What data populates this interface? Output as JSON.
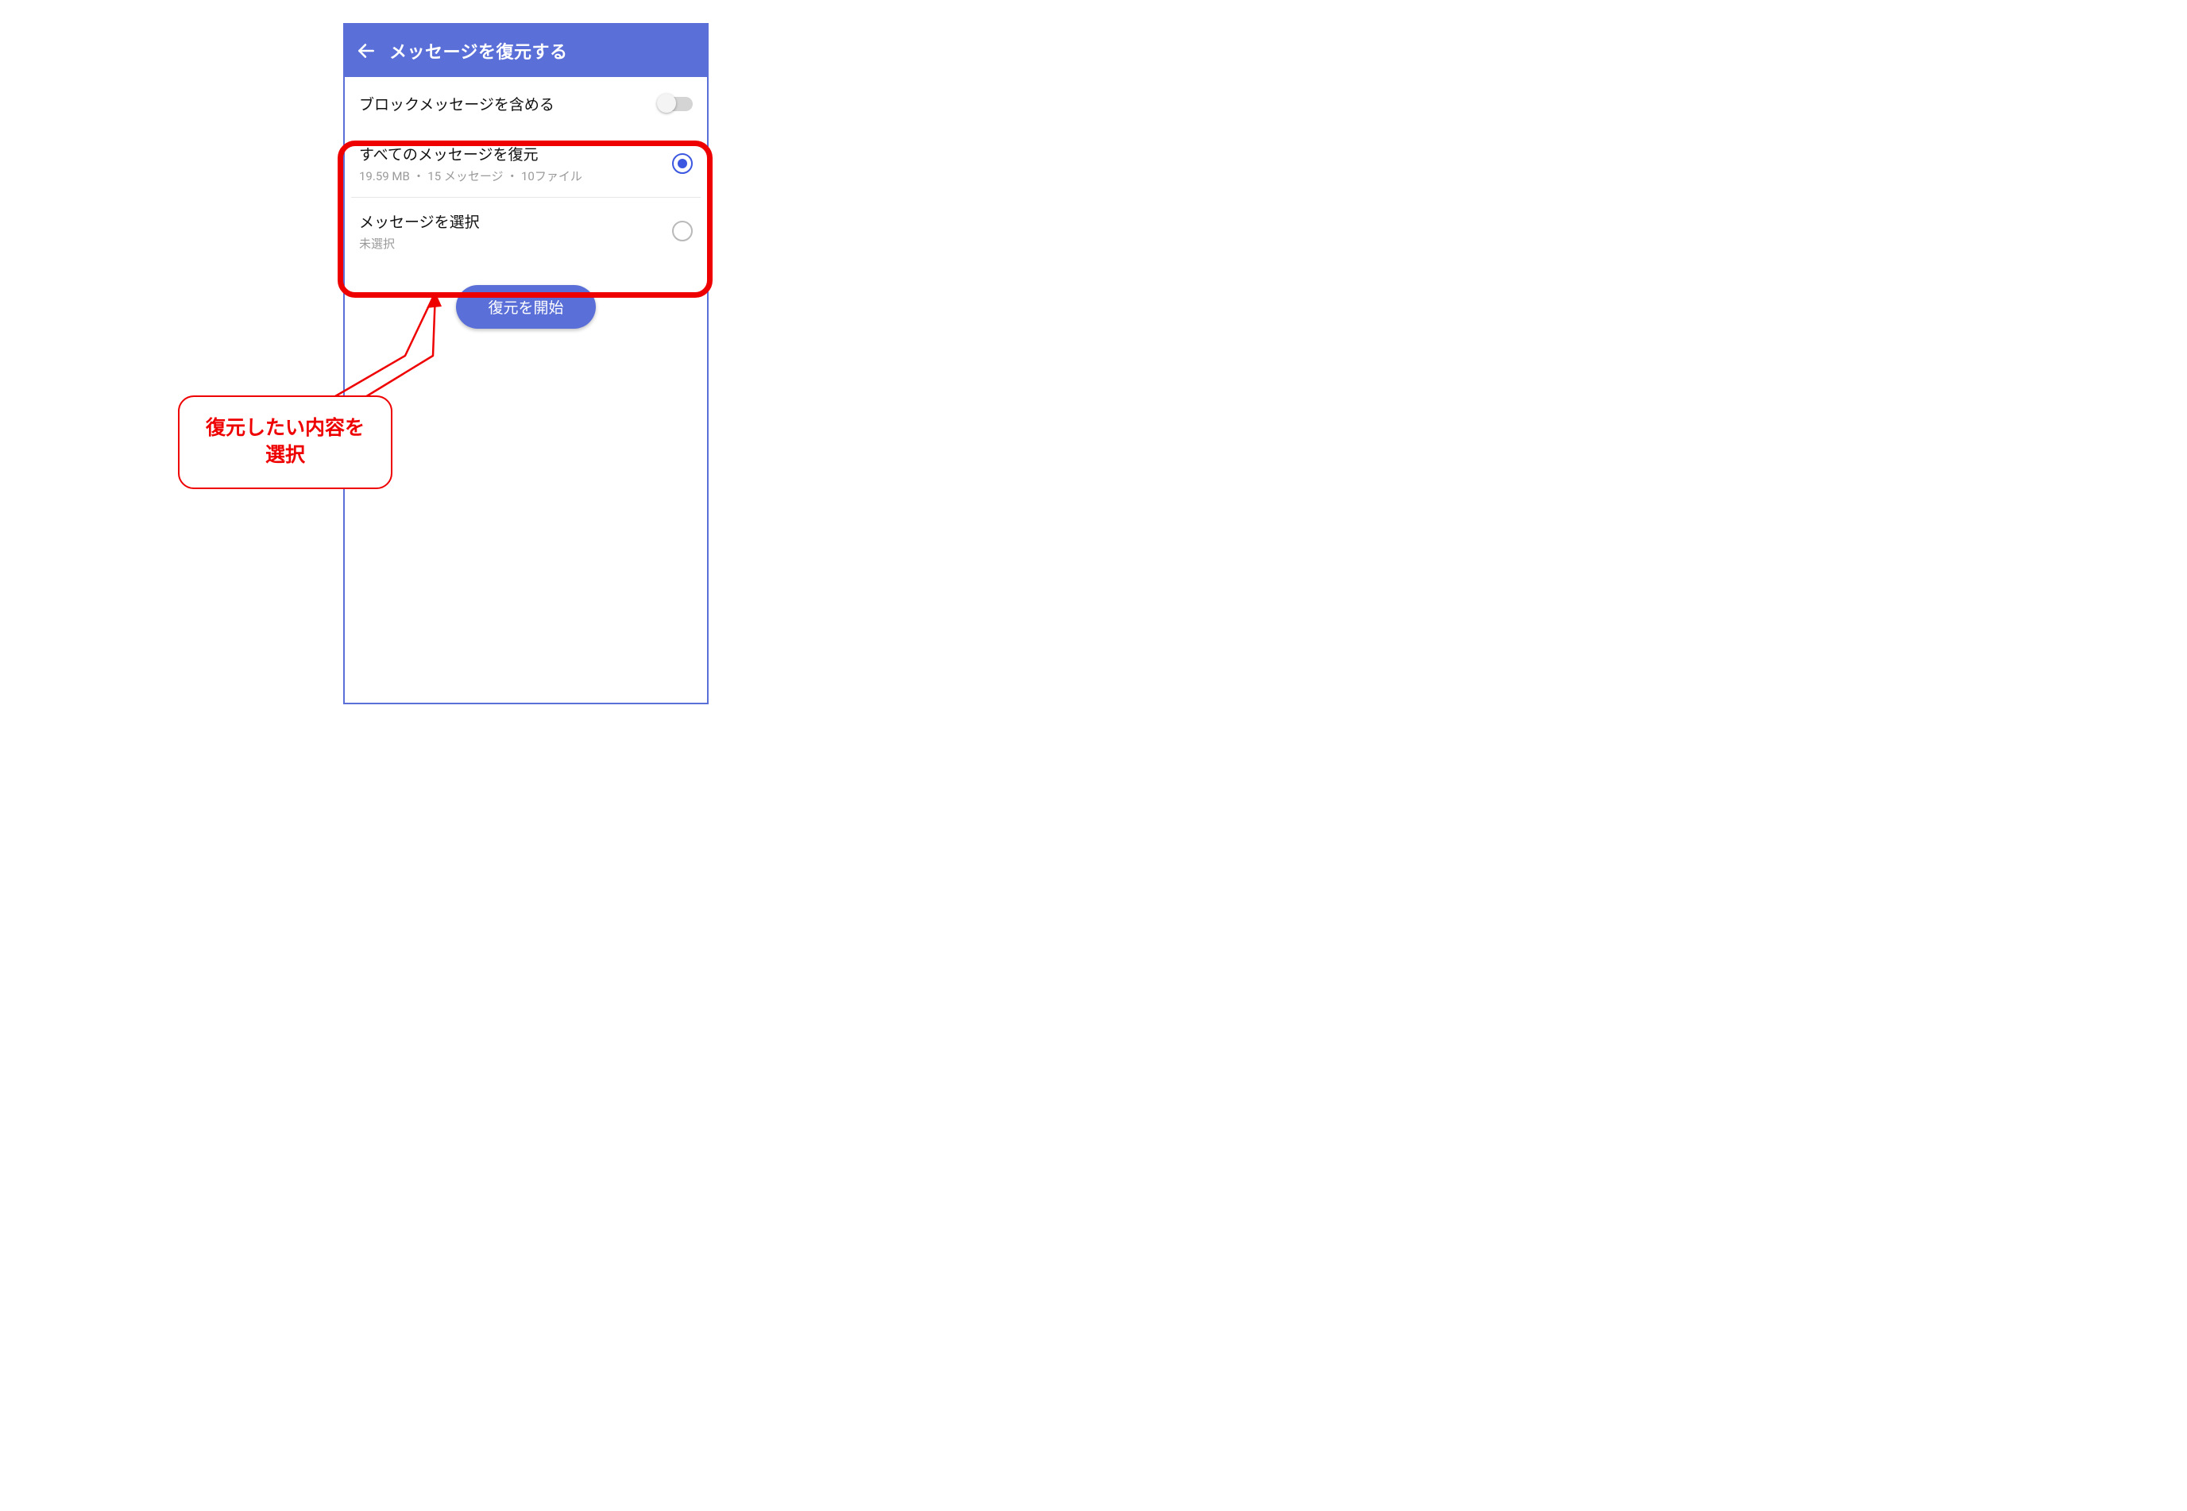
{
  "colors": {
    "primary": "#5a6fd8",
    "accent": "#3c57e0",
    "annotation": "#ef0000"
  },
  "app_bar": {
    "back_icon": "back-arrow-icon",
    "title": "メッセージを復元する"
  },
  "rows": {
    "include_blocked": {
      "label": "ブロックメッセージを含める",
      "toggle_on": false
    }
  },
  "options": {
    "restore_all": {
      "title": "すべてのメッセージを復元",
      "sub_size": "19.59 MB",
      "sub_messages": "15 メッセージ",
      "sub_files": "10ファイル",
      "sub_full": "19.59 MB ・ 15 メッセージ ・ 10ファイル",
      "selected": true
    },
    "select_messages": {
      "title": "メッセージを選択",
      "sub": "未選択",
      "selected": false
    }
  },
  "primary_button": {
    "label": "復元を開始"
  },
  "annotation": {
    "callout_line1": "復元したい内容を",
    "callout_line2": "選択"
  }
}
